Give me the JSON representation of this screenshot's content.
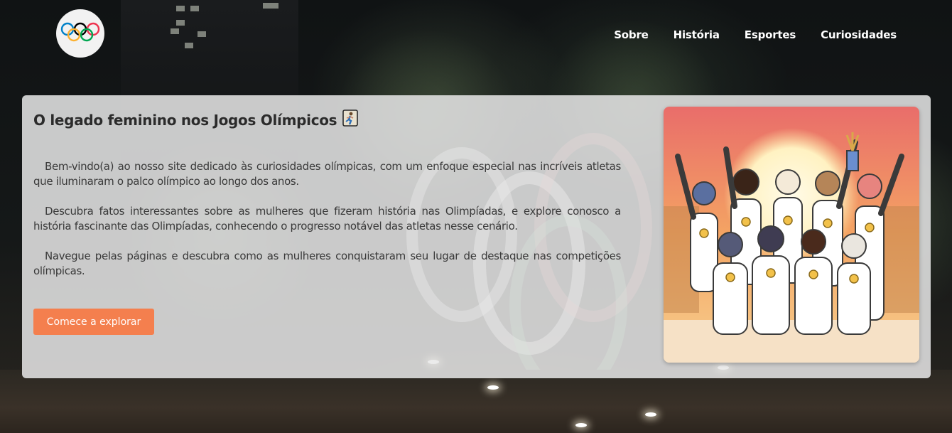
{
  "header": {
    "logo_icon": "olympic-rings-icon",
    "nav": [
      {
        "label": "Sobre"
      },
      {
        "label": "História"
      },
      {
        "label": "Esportes"
      },
      {
        "label": "Curiosidades"
      }
    ]
  },
  "hero": {
    "title": "O legado feminino nos Jogos Olímpicos",
    "title_icon": "woman-running-emoji-icon",
    "paragraphs": [
      "Bem-vindo(a) ao nosso site dedicado às curiosidades olímpicas, com um enfoque especial nas incríveis atletas que iluminaram o palco olímpico ao longo dos anos.",
      "Descubra fatos interessantes sobre as mulheres que fizeram história nas Olimpíadas, e explore conosco a história fascinante das Olimpíadas, conhecendo o progresso notável das atletas nesse cenário.",
      "Navegue pelas páginas e descubra como as mulheres conquistaram seu lugar de destaque nas competições olímpicas."
    ],
    "cta_label": "Comece a explorar",
    "illustration": "female-olympic-athletes-illustration"
  },
  "colors": {
    "accent": "#f47f4e",
    "card_bg": "#e8e8e8",
    "ring_blue": "#0081c8",
    "ring_yellow": "#fcb131",
    "ring_black": "#000000",
    "ring_green": "#00a651",
    "ring_red": "#ee334e"
  }
}
